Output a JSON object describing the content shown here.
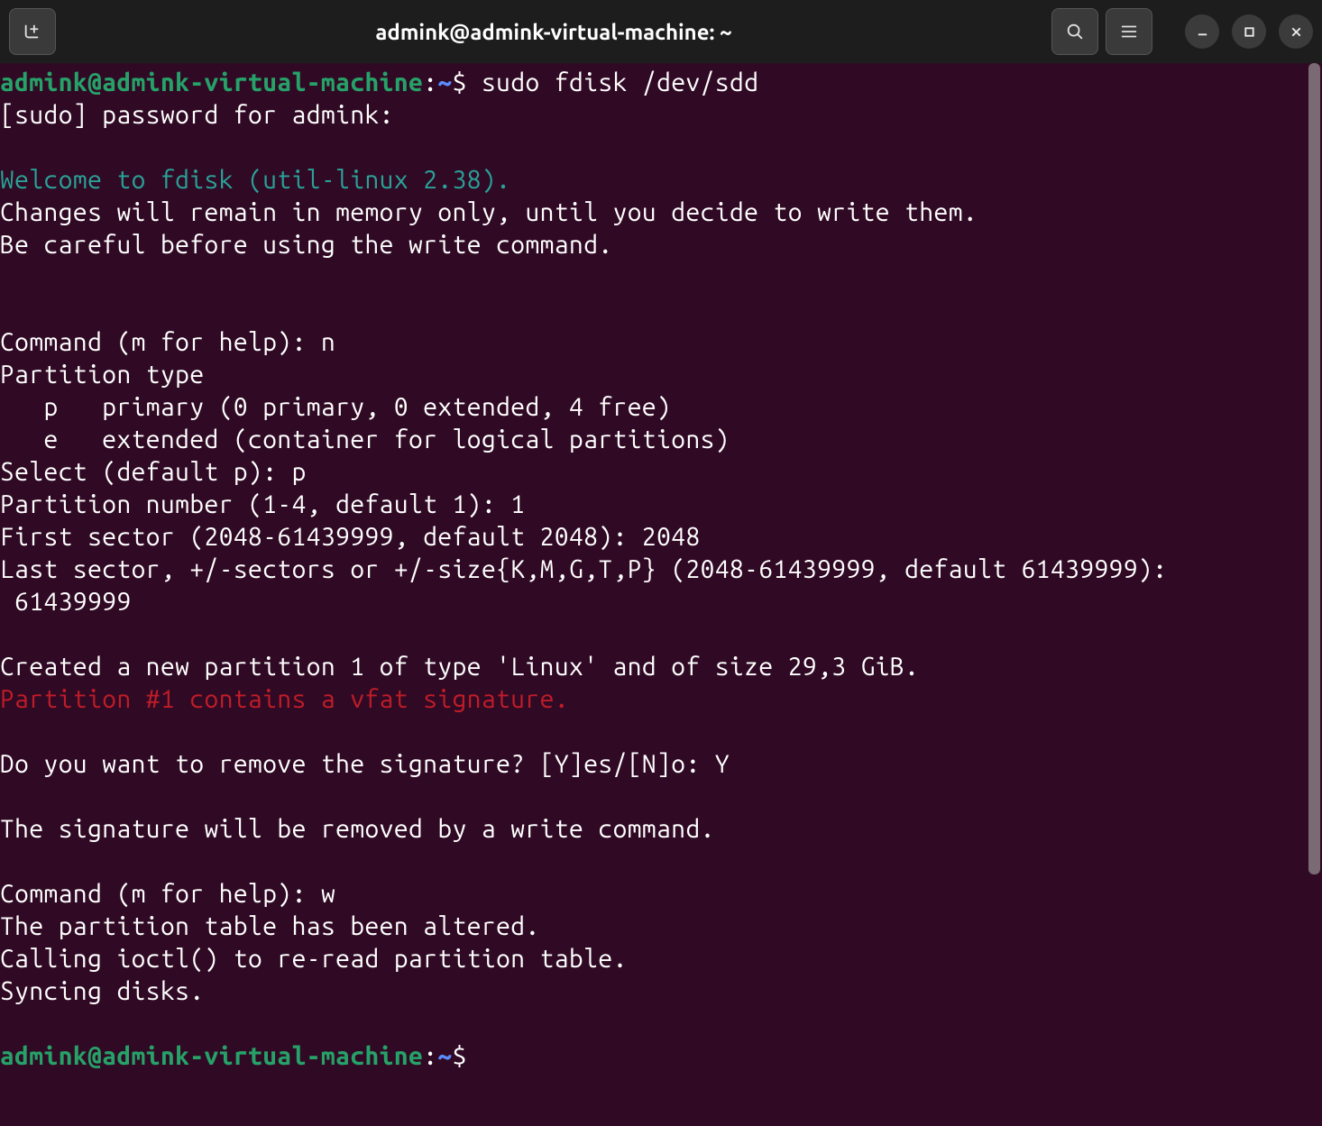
{
  "titlebar": {
    "title": "admink@admink-virtual-machine: ~"
  },
  "prompt1": {
    "userhost": "admink@admink-virtual-machine",
    "sep": ":",
    "path": "~",
    "dollar": "$",
    "command": " sudo fdisk /dev/sdd"
  },
  "lines": {
    "sudo_prompt": "[sudo] password for admink: ",
    "welcome": "Welcome to fdisk (util-linux 2.38).",
    "changes": "Changes will remain in memory only, until you decide to write them.",
    "careful": "Be careful before using the write command.",
    "cmd_n": "Command (m for help): n",
    "ptype": "Partition type",
    "p_primary": "   p   primary (0 primary, 0 extended, 4 free)",
    "p_extended": "   e   extended (container for logical partitions)",
    "select_p": "Select (default p): p",
    "part_num": "Partition number (1-4, default 1): 1",
    "first_sector": "First sector (2048-61439999, default 2048): 2048",
    "last_sector": "Last sector, +/-sectors or +/-size{K,M,G,T,P} (2048-61439999, default 61439999):\n 61439999",
    "created": "Created a new partition 1 of type 'Linux' and of size 29,3 GiB.",
    "vfat": "Partition #1 contains a vfat signature.",
    "remove_sig": "Do you want to remove the signature? [Y]es/[N]o: Y",
    "will_remove": "The signature will be removed by a write command.",
    "cmd_w": "Command (m for help): w",
    "altered": "The partition table has been altered.",
    "ioctl": "Calling ioctl() to re-read partition table.",
    "syncing": "Syncing disks."
  },
  "prompt2": {
    "userhost": "admink@admink-virtual-machine",
    "sep": ":",
    "path": "~",
    "dollar": "$"
  }
}
